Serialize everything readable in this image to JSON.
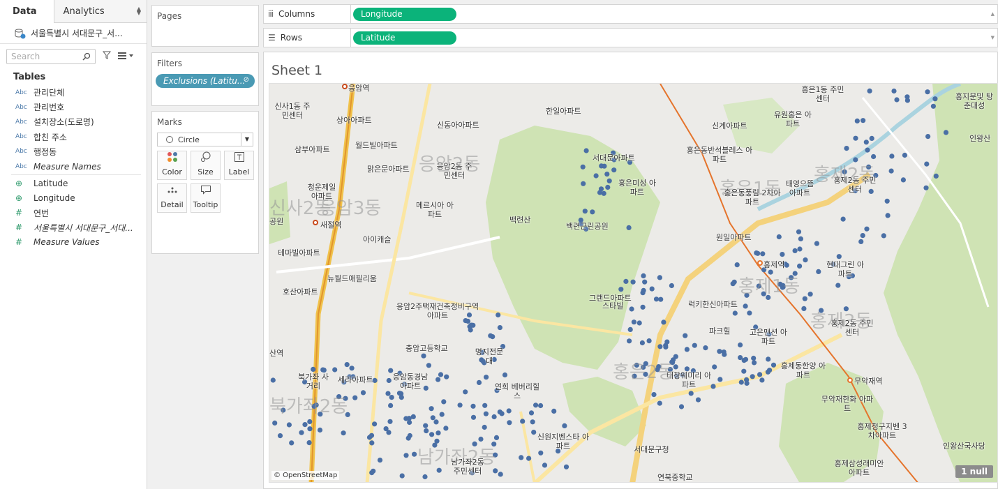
{
  "data_pane": {
    "tabs": [
      "Data",
      "Analytics"
    ],
    "datasource": "서울특별시 서대문구_서...",
    "search_placeholder": "Search",
    "tables_heading": "Tables",
    "fields": [
      {
        "type": "Abc",
        "name": "관리단체"
      },
      {
        "type": "Abc",
        "name": "관리번호"
      },
      {
        "type": "Abc",
        "name": "설치장소(도로명)"
      },
      {
        "type": "Abc",
        "name": "합친 주소"
      },
      {
        "type": "Abc",
        "name": "행정동"
      },
      {
        "type": "Abc",
        "name": "Measure Names"
      },
      {
        "type": "globe",
        "name": "Latitude"
      },
      {
        "type": "globe",
        "name": "Longitude"
      },
      {
        "type": "#",
        "name": "연번"
      },
      {
        "type": "#",
        "name": "서울특별시 서대문구_서대..."
      },
      {
        "type": "#",
        "name": "Measure Values"
      }
    ]
  },
  "cards": {
    "pages": "Pages",
    "filters": "Filters",
    "filter_pill": "Exclusions (Latitu...",
    "marks": "Marks",
    "mark_type": "Circle",
    "mark_buttons": [
      "Color",
      "Size",
      "Label",
      "Detail",
      "Tooltip"
    ]
  },
  "shelves": {
    "columns_label": "Columns",
    "columns_pill": "Longitude",
    "rows_label": "Rows",
    "rows_pill": "Latitude"
  },
  "view": {
    "sheet_title": "Sheet 1",
    "attribution": "© OpenStreetMap",
    "null_badge": "1 null"
  },
  "map_labels": {
    "district": [
      "신사2동",
      "응암3동",
      "응암2동",
      "홍은1동",
      "홍은2동",
      "홍제1동",
      "홍제2동",
      "홍제3동",
      "남가좌2동",
      "북가좌2동"
    ],
    "places": [
      "응암역",
      "신사1동 주민센터",
      "상아아파트",
      "한일아파트",
      "신동아아파트",
      "월드빌아파트",
      "삼부아파트",
      "맑은문아파트",
      "응암2동 주민센터",
      "청운제일 아파트",
      "새절역",
      "메르시아 아파트",
      "아이캐슬",
      "뉴월드애필리움",
      "호산아파트",
      "응암2주택재건축정비구역 아파트",
      "충암고등학교",
      "명지전문대",
      "세라아파트",
      "응암동경남 아파트",
      "연희 베버리힐스",
      "북가좌 사거리",
      "신원지벤스타 아파트",
      "서대문구청",
      "남가좌2동 주민센터",
      "백련산",
      "백련근린공원",
      "그랜드아파트",
      "스타빌",
      "서대문아파트",
      "홍은미성 아파트",
      "홍은동반석블레스 아파트",
      "홍은동풍림 2차아파트",
      "신계아파트",
      "유원홍은 아파트",
      "홍은1동 주민센터",
      "태영으뜸 아파트",
      "홍제2동 주민센터",
      "홍제역",
      "원일아파트",
      "현대그린 아파트",
      "럭키한신아파트",
      "파크힐",
      "고은맨션 아파트",
      "홍제2동 주민센터",
      "홍제동한양 아파트",
      "태창웨미리 아파트",
      "무악재역",
      "무악재한화 아파트",
      "홍제청구지벤 3차아파트",
      "홍제삼성래미안 아파트",
      "인왕산",
      "홍지문및 탕춘대성",
      "인왕산국사당",
      "연북중학교",
      "공원",
      "테마빌아파트",
      "산역"
    ]
  },
  "colors": {
    "pill_green": "#0bb37a",
    "filter_pill": "#4a9ab4",
    "dot": "#4a6fa5"
  }
}
